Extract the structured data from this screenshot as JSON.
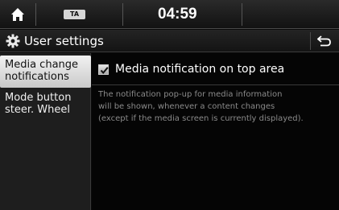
{
  "status_bar": {
    "home_icon": "home-icon",
    "ta_label": "TA",
    "time": "04:59"
  },
  "title_bar": {
    "icon": "gear-icon",
    "title": "User settings",
    "back_icon": "back-arrow-icon"
  },
  "menu": {
    "items": [
      {
        "line1": "Media change",
        "line2": "notifications",
        "active": true
      },
      {
        "line1": "Mode button",
        "line2": "steer. Wheel",
        "active": false
      }
    ]
  },
  "content": {
    "option": {
      "label": "Media notification on top area",
      "checked": true
    },
    "description": [
      "The notification pop-up for media information",
      "will be shown, whenever a content changes",
      "(except if the media screen is currently displayed)."
    ]
  }
}
